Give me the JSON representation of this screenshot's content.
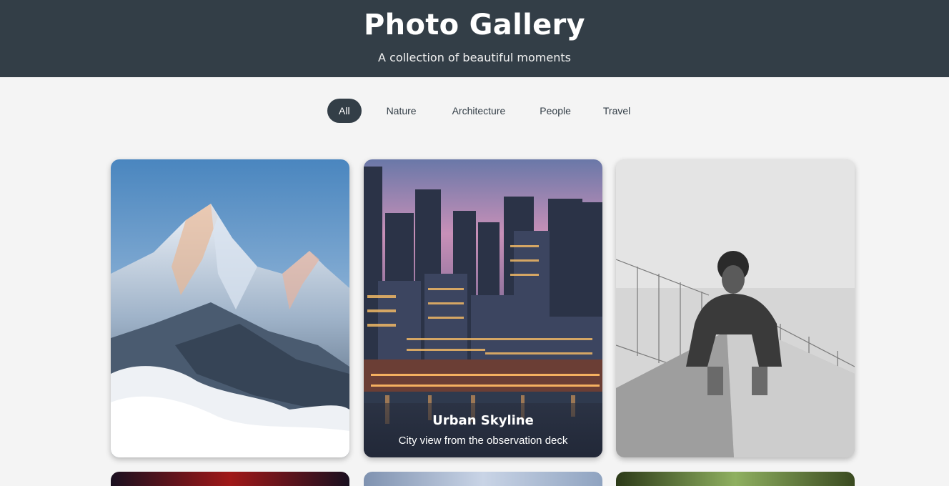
{
  "header": {
    "title": "Photo Gallery",
    "subtitle": "A collection of beautiful moments"
  },
  "filters": [
    {
      "label": "All",
      "active": true
    },
    {
      "label": "Nature",
      "active": false
    },
    {
      "label": "Architecture",
      "active": false
    },
    {
      "label": "People",
      "active": false
    },
    {
      "label": "Travel",
      "active": false
    }
  ],
  "gallery": {
    "cards": [
      {
        "image": "snowy-mountain-peak",
        "title": "",
        "description": ""
      },
      {
        "image": "city-skyline-at-dusk",
        "title": "Urban Skyline",
        "description": "City view from the observation deck",
        "caption_visible": true
      },
      {
        "image": "man-on-concrete-wall-bw",
        "title": "",
        "description": ""
      }
    ]
  },
  "colors": {
    "header_bg": "#333e47",
    "page_bg": "#f4f4f4",
    "active_filter_bg": "#333e47"
  }
}
